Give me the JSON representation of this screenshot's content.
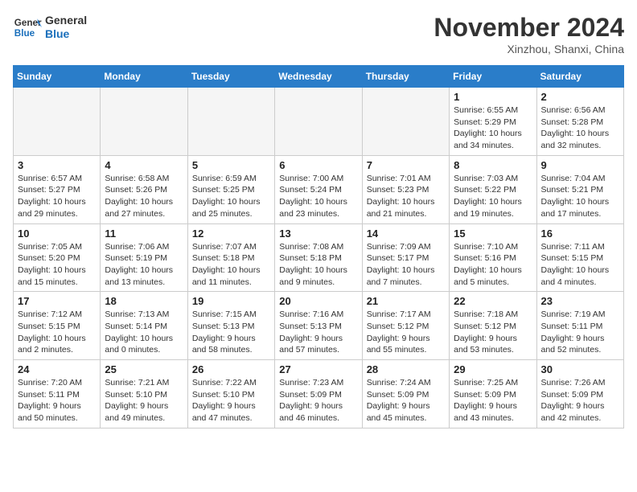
{
  "header": {
    "logo_line1": "General",
    "logo_line2": "Blue",
    "month": "November 2024",
    "location": "Xinzhou, Shanxi, China"
  },
  "days_of_week": [
    "Sunday",
    "Monday",
    "Tuesday",
    "Wednesday",
    "Thursday",
    "Friday",
    "Saturday"
  ],
  "weeks": [
    [
      {
        "day": "",
        "empty": true
      },
      {
        "day": "",
        "empty": true
      },
      {
        "day": "",
        "empty": true
      },
      {
        "day": "",
        "empty": true
      },
      {
        "day": "",
        "empty": true
      },
      {
        "day": "1",
        "sunrise": "6:55 AM",
        "sunset": "5:29 PM",
        "daylight": "10 hours and 34 minutes."
      },
      {
        "day": "2",
        "sunrise": "6:56 AM",
        "sunset": "5:28 PM",
        "daylight": "10 hours and 32 minutes."
      }
    ],
    [
      {
        "day": "3",
        "sunrise": "6:57 AM",
        "sunset": "5:27 PM",
        "daylight": "10 hours and 29 minutes."
      },
      {
        "day": "4",
        "sunrise": "6:58 AM",
        "sunset": "5:26 PM",
        "daylight": "10 hours and 27 minutes."
      },
      {
        "day": "5",
        "sunrise": "6:59 AM",
        "sunset": "5:25 PM",
        "daylight": "10 hours and 25 minutes."
      },
      {
        "day": "6",
        "sunrise": "7:00 AM",
        "sunset": "5:24 PM",
        "daylight": "10 hours and 23 minutes."
      },
      {
        "day": "7",
        "sunrise": "7:01 AM",
        "sunset": "5:23 PM",
        "daylight": "10 hours and 21 minutes."
      },
      {
        "day": "8",
        "sunrise": "7:03 AM",
        "sunset": "5:22 PM",
        "daylight": "10 hours and 19 minutes."
      },
      {
        "day": "9",
        "sunrise": "7:04 AM",
        "sunset": "5:21 PM",
        "daylight": "10 hours and 17 minutes."
      }
    ],
    [
      {
        "day": "10",
        "sunrise": "7:05 AM",
        "sunset": "5:20 PM",
        "daylight": "10 hours and 15 minutes."
      },
      {
        "day": "11",
        "sunrise": "7:06 AM",
        "sunset": "5:19 PM",
        "daylight": "10 hours and 13 minutes."
      },
      {
        "day": "12",
        "sunrise": "7:07 AM",
        "sunset": "5:18 PM",
        "daylight": "10 hours and 11 minutes."
      },
      {
        "day": "13",
        "sunrise": "7:08 AM",
        "sunset": "5:18 PM",
        "daylight": "10 hours and 9 minutes."
      },
      {
        "day": "14",
        "sunrise": "7:09 AM",
        "sunset": "5:17 PM",
        "daylight": "10 hours and 7 minutes."
      },
      {
        "day": "15",
        "sunrise": "7:10 AM",
        "sunset": "5:16 PM",
        "daylight": "10 hours and 5 minutes."
      },
      {
        "day": "16",
        "sunrise": "7:11 AM",
        "sunset": "5:15 PM",
        "daylight": "10 hours and 4 minutes."
      }
    ],
    [
      {
        "day": "17",
        "sunrise": "7:12 AM",
        "sunset": "5:15 PM",
        "daylight": "10 hours and 2 minutes."
      },
      {
        "day": "18",
        "sunrise": "7:13 AM",
        "sunset": "5:14 PM",
        "daylight": "10 hours and 0 minutes."
      },
      {
        "day": "19",
        "sunrise": "7:15 AM",
        "sunset": "5:13 PM",
        "daylight": "9 hours and 58 minutes."
      },
      {
        "day": "20",
        "sunrise": "7:16 AM",
        "sunset": "5:13 PM",
        "daylight": "9 hours and 57 minutes."
      },
      {
        "day": "21",
        "sunrise": "7:17 AM",
        "sunset": "5:12 PM",
        "daylight": "9 hours and 55 minutes."
      },
      {
        "day": "22",
        "sunrise": "7:18 AM",
        "sunset": "5:12 PM",
        "daylight": "9 hours and 53 minutes."
      },
      {
        "day": "23",
        "sunrise": "7:19 AM",
        "sunset": "5:11 PM",
        "daylight": "9 hours and 52 minutes."
      }
    ],
    [
      {
        "day": "24",
        "sunrise": "7:20 AM",
        "sunset": "5:11 PM",
        "daylight": "9 hours and 50 minutes."
      },
      {
        "day": "25",
        "sunrise": "7:21 AM",
        "sunset": "5:10 PM",
        "daylight": "9 hours and 49 minutes."
      },
      {
        "day": "26",
        "sunrise": "7:22 AM",
        "sunset": "5:10 PM",
        "daylight": "9 hours and 47 minutes."
      },
      {
        "day": "27",
        "sunrise": "7:23 AM",
        "sunset": "5:09 PM",
        "daylight": "9 hours and 46 minutes."
      },
      {
        "day": "28",
        "sunrise": "7:24 AM",
        "sunset": "5:09 PM",
        "daylight": "9 hours and 45 minutes."
      },
      {
        "day": "29",
        "sunrise": "7:25 AM",
        "sunset": "5:09 PM",
        "daylight": "9 hours and 43 minutes."
      },
      {
        "day": "30",
        "sunrise": "7:26 AM",
        "sunset": "5:09 PM",
        "daylight": "9 hours and 42 minutes."
      }
    ]
  ]
}
